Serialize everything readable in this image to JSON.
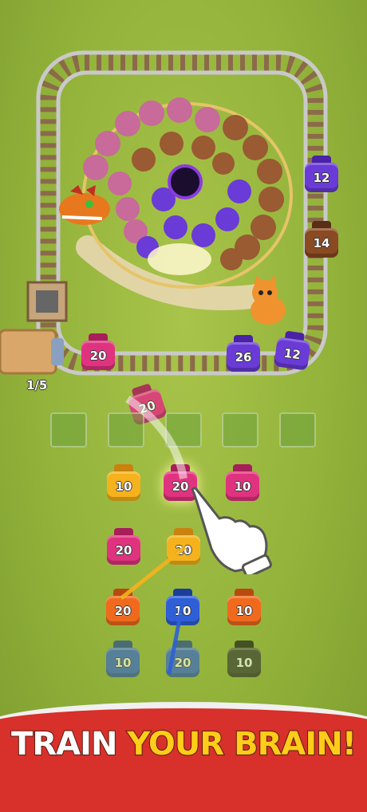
{
  "game": {
    "counter": "1/5",
    "banner": {
      "part1": "TRAIN ",
      "part2": "YOUR BRAIN!"
    },
    "colors": {
      "pink": "#e0337f",
      "purple": "#6a3bd6",
      "yellow": "#f5b21d",
      "orange": "#f06a1e",
      "blue": "#2f5fd6",
      "brown": "#8a4a22",
      "grass": "#93b33b",
      "banner_red": "#d8302a",
      "banner_yellow": "#ffcc1a"
    },
    "track_jars": [
      {
        "value": "12",
        "color": "purple"
      },
      {
        "value": "14",
        "color": "brown"
      },
      {
        "value": "20",
        "color": "pink"
      },
      {
        "value": "26",
        "color": "purple"
      },
      {
        "value": "12",
        "color": "purple"
      }
    ],
    "flying_jar": {
      "value": "20",
      "color": "pink"
    },
    "grid_rows": [
      [
        {
          "value": "10",
          "color": "yellow"
        },
        {
          "value": "20",
          "color": "pink"
        },
        {
          "value": "10",
          "color": "pink"
        }
      ],
      [
        {
          "value": "20",
          "color": "pink"
        },
        {
          "value": "20",
          "color": "yellow"
        }
      ],
      [
        {
          "value": "20",
          "color": "orange"
        },
        {
          "value": "10",
          "color": "blue"
        },
        {
          "value": "10",
          "color": "orange"
        }
      ],
      [
        {
          "value": "10",
          "color": "blue"
        },
        {
          "value": "20",
          "color": "blue"
        },
        {
          "value": "10",
          "color": "black"
        }
      ]
    ],
    "icons": [
      "dragon-icon",
      "black-hole-icon",
      "cat-icon",
      "cannon-icon",
      "hand-pointer-icon",
      "mine-cart-icon"
    ]
  }
}
